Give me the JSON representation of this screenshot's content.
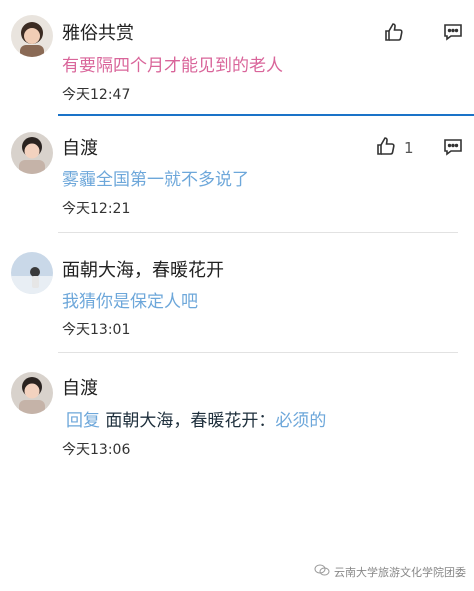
{
  "comments": [
    {
      "username": "雅俗共赏",
      "text": "有要隔四个月才能见到的老人",
      "time": "今天12:47",
      "like_count": "",
      "text_color": "#d9659a"
    },
    {
      "username": "自渡",
      "text": "雾霾全国第一就不多说了",
      "time": "今天12:21",
      "like_count": "1",
      "text_color": "#6da7da"
    },
    {
      "username": "面朝大海，春暖花开",
      "text": "我猜你是保定人吧",
      "time": "今天13:01",
      "like_count": "",
      "text_color": "#6da7da"
    },
    {
      "username": "自渡",
      "reply_label": "回复",
      "reply_target": "面朝大海，春暖花开：",
      "text": "必须的",
      "time": "今天13:06",
      "text_color": "#6da7da"
    }
  ],
  "watermark": "云南大学旅游文化学院团委",
  "colors": {
    "accent_blue": "#6da7da",
    "accent_pink": "#d9659a",
    "highlight_line": "#1a73c8"
  }
}
